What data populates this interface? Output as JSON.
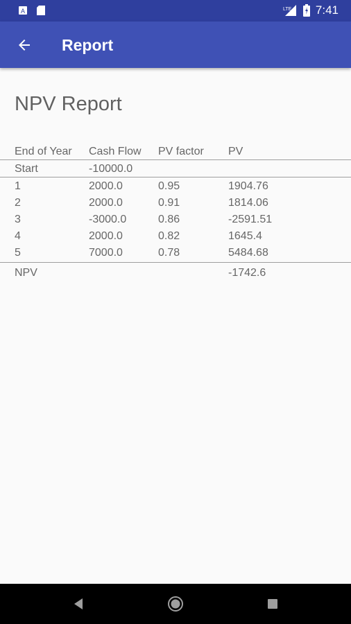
{
  "status_bar": {
    "time": "7:41",
    "network": "LTE"
  },
  "app_bar": {
    "title": "Report"
  },
  "page": {
    "title": "NPV Report"
  },
  "table": {
    "headers": [
      "End of Year",
      "Cash Flow",
      "PV factor",
      "PV"
    ],
    "start": [
      "Start",
      "-10000.0",
      "",
      ""
    ],
    "rows": [
      [
        "1",
        "2000.0",
        "0.95",
        "1904.76"
      ],
      [
        "2",
        "2000.0",
        "0.91",
        "1814.06"
      ],
      [
        "3",
        "-3000.0",
        "0.86",
        "-2591.51"
      ],
      [
        "4",
        "2000.0",
        "0.82",
        "1645.4"
      ],
      [
        "5",
        "7000.0",
        "0.78",
        "5484.68"
      ]
    ],
    "total": [
      "NPV",
      "",
      "",
      "-1742.6"
    ]
  },
  "icons": {
    "back": "arrow-back-icon",
    "nav_back": "triangle-back-icon",
    "nav_home": "circle-home-icon",
    "nav_recents": "square-recents-icon"
  },
  "colors": {
    "app_bar": "#3f51b5",
    "status_bar": "#2f3f9e"
  }
}
